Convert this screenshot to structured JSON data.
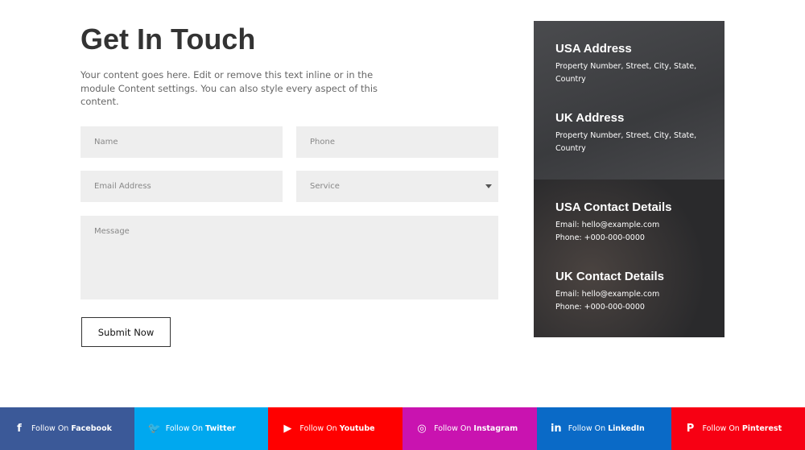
{
  "title": "Get In Touch",
  "intro": "Your content goes here. Edit or remove this text inline or in the module Content settings. You can also style every aspect of this content.",
  "form": {
    "name": "Name",
    "phone": "Phone",
    "email": "Email Address",
    "service": "Service",
    "message": "Message",
    "submit": "Submit Now"
  },
  "panel": [
    {
      "heading": "USA Address",
      "lines": [
        "Property Number, Street, City, State, Country"
      ]
    },
    {
      "heading": "UK Address",
      "lines": [
        "Property Number, Street, City, State, Country"
      ]
    },
    {
      "heading": "USA Contact Details",
      "lines": [
        "Email: hello@example.com",
        "Phone: +000-000-0000"
      ]
    },
    {
      "heading": "UK Contact Details",
      "lines": [
        "Email: hello@example.com",
        "Phone: +000-000-0000"
      ]
    }
  ],
  "social": [
    {
      "prefix": "Follow On",
      "name": "Facebook",
      "icon": "facebook-icon",
      "color": "#3b5998"
    },
    {
      "prefix": "Follow On",
      "name": "Twitter",
      "icon": "twitter-icon",
      "color": "#00a8ef"
    },
    {
      "prefix": "Follow On",
      "name": "Youtube",
      "icon": "youtube-icon",
      "color": "#ff0000"
    },
    {
      "prefix": "Follow On",
      "name": "Instagram",
      "icon": "instagram-icon",
      "color": "#c913b0"
    },
    {
      "prefix": "Follow On",
      "name": "LinkedIn",
      "icon": "linkedin-icon",
      "color": "#0a6ac7"
    },
    {
      "prefix": "Follow On",
      "name": "Pinterest",
      "icon": "pinterest-icon",
      "color": "#f70013"
    }
  ]
}
